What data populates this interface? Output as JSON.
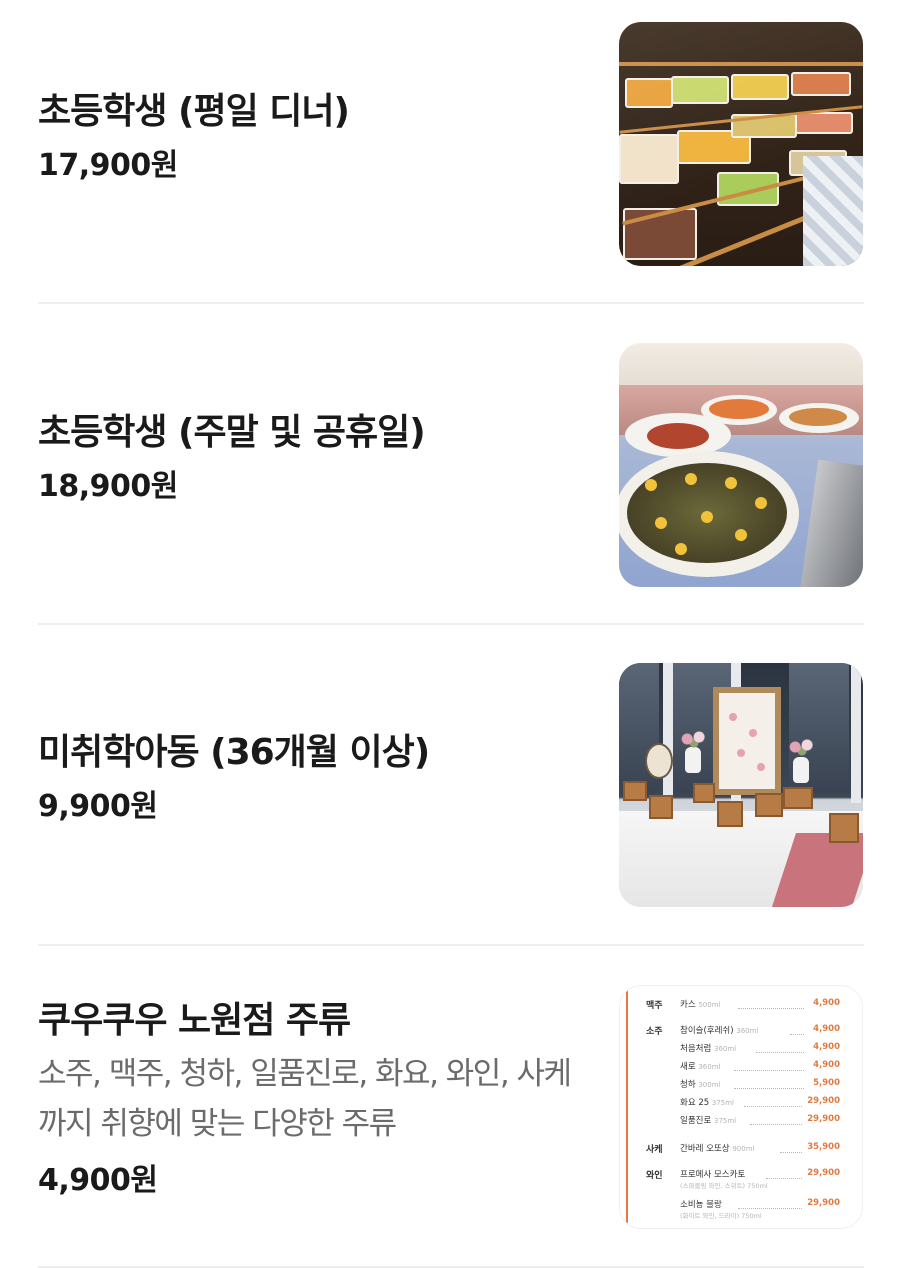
{
  "menu": {
    "items": [
      {
        "title": "초등학생 (평일 디너)",
        "description": "",
        "price": "17,900원",
        "image": "buffet-display-photo"
      },
      {
        "title": "초등학생 (주말 및 공휴일)",
        "description": "",
        "price": "18,900원",
        "image": "seafood-platter-photo"
      },
      {
        "title": "미취학아동 (36개월 이상)",
        "description": "",
        "price": "9,900원",
        "image": "display-table-photo"
      },
      {
        "title": "쿠우쿠우 노원점 주류",
        "description": "소주, 맥주, 청하, 일품진로, 화요, 와인, 사케 까지 취향에 맞는 다양한 주류",
        "price": "4,900원",
        "image": "drinks-menu-card"
      }
    ]
  },
  "drinks_card": {
    "rows": [
      {
        "category": "맥주",
        "name": "카스",
        "volume": "500ml",
        "price": "4,900"
      },
      {
        "category": "소주",
        "name": "참이슬(후레쉬)",
        "volume": "360ml",
        "price": "4,900"
      },
      {
        "category": "",
        "name": "처음처럼",
        "volume": "360ml",
        "price": "4,900"
      },
      {
        "category": "",
        "name": "새로",
        "volume": "360ml",
        "price": "4,900"
      },
      {
        "category": "",
        "name": "청하",
        "volume": "300ml",
        "price": "5,900"
      },
      {
        "category": "",
        "name": "화요 25",
        "volume": "375ml",
        "price": "29,900"
      },
      {
        "category": "",
        "name": "일품진로",
        "volume": "375ml",
        "price": "29,900"
      },
      {
        "category": "사케",
        "name": "간바레 오또상",
        "volume": "900ml",
        "price": "35,900"
      },
      {
        "category": "와인",
        "name": "프로메사 모스카토",
        "volume": "",
        "price": "29,900",
        "note": "(스파클링 와인, 스위트) 750ml"
      },
      {
        "category": "",
        "name": "소비뇽 블랑",
        "volume": "",
        "price": "29,900",
        "note": "(화이트 와인, 드라이) 750ml"
      }
    ]
  },
  "colors": {
    "title": "#1a1a1a",
    "description": "#6b6b6b",
    "divider": "#eeeeee",
    "card_accent": "#e07a3e"
  }
}
